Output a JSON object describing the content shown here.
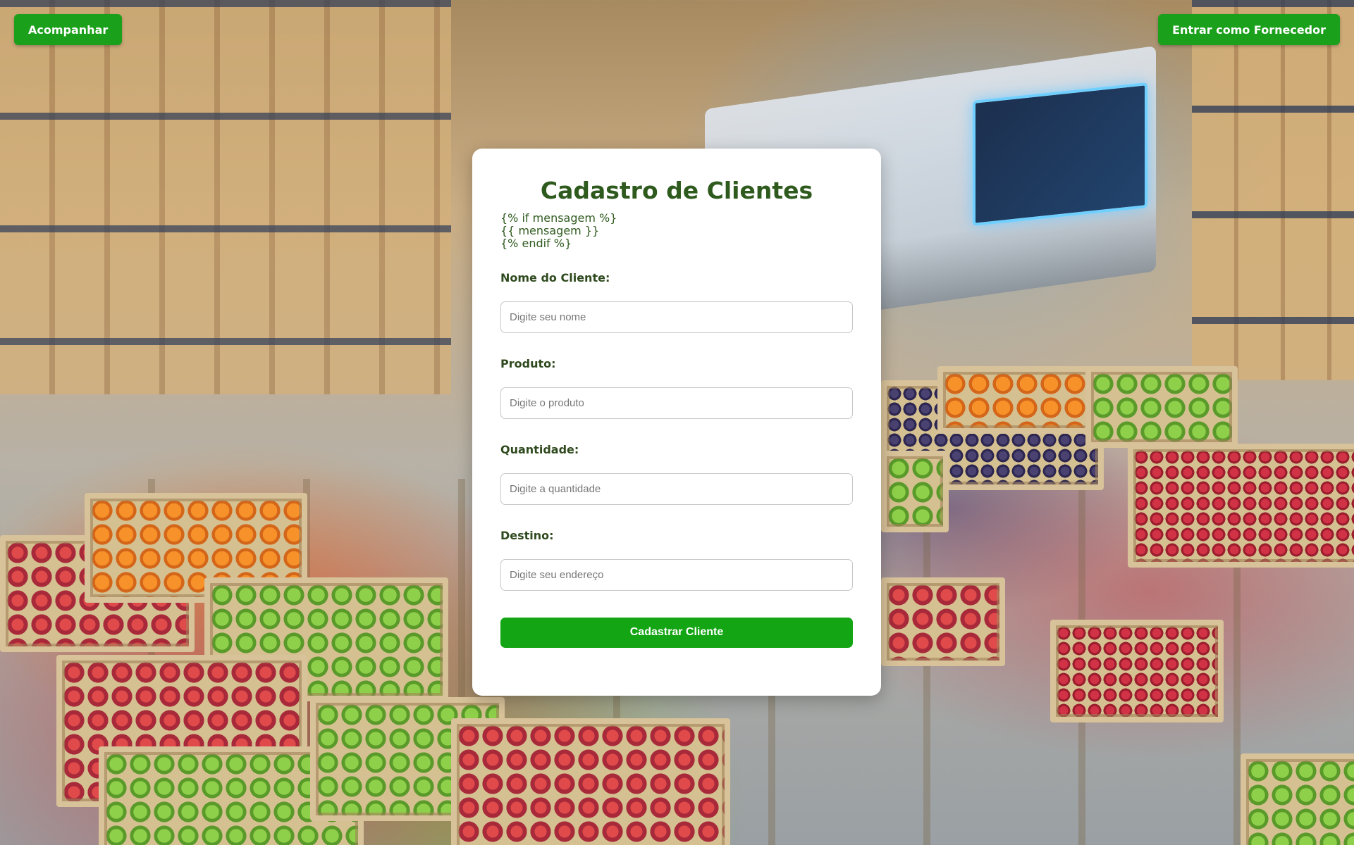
{
  "nav": {
    "track_label": "Acompanhar",
    "supplier_label": "Entrar como Fornecedor"
  },
  "form": {
    "title": "Cadastro de Clientes",
    "template_lines": [
      "{% if mensagem %}",
      "{{ mensagem }}",
      "{% endif %}"
    ],
    "fields": [
      {
        "label": "Nome do Cliente:",
        "placeholder": "Digite seu nome",
        "value": ""
      },
      {
        "label": "Produto:",
        "placeholder": "Digite o produto",
        "value": ""
      },
      {
        "label": "Quantidade:",
        "placeholder": "Digite a quantidade",
        "value": ""
      },
      {
        "label": "Destino:",
        "placeholder": "Digite seu endereço",
        "value": ""
      }
    ],
    "submit_label": "Cadastrar Cliente"
  },
  "colors": {
    "button_green": "#14a514",
    "title_green": "#2f5a1e",
    "card_bg": "#ffffff"
  }
}
